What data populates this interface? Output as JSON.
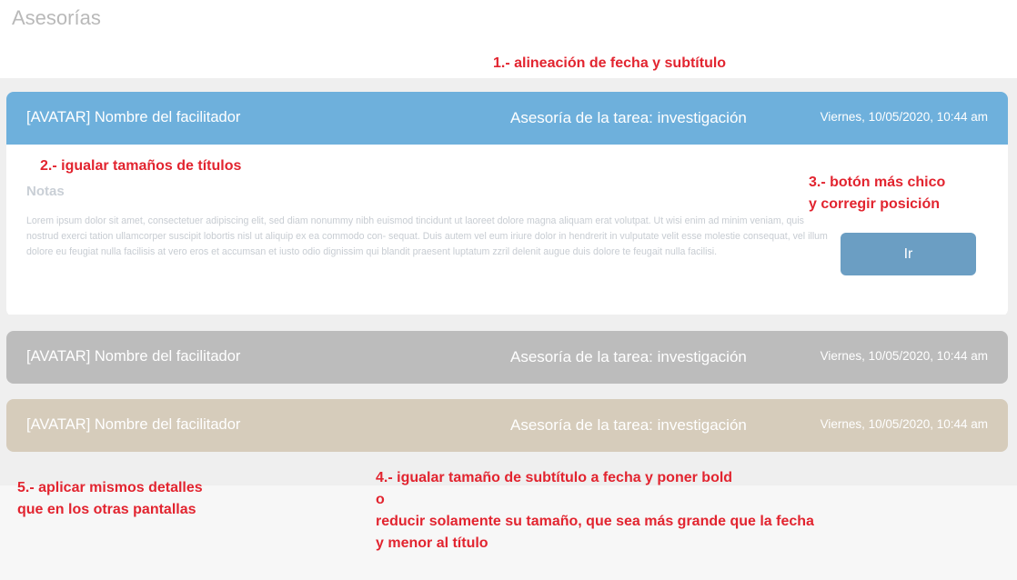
{
  "page": {
    "title": "Asesorías"
  },
  "notes": {
    "n1": "1.- alineación de fecha y subtítulo",
    "n2": "2.- igualar tamaños de títulos",
    "n3": "3.- botón más chico\ny corregir posición",
    "n4": "4.- igualar tamaño de subtítulo a fecha y poner bold\no\nreducir solamente su tamaño, que sea más grande que la fecha\ny menor al título",
    "n5": "5.- aplicar mismos detalles\nque en los otras pantallas"
  },
  "cards": [
    {
      "name": "[AVATAR] Nombre del facilitador",
      "subtitle": "Asesoría de la tarea: investigación",
      "date": "Viernes, 10/05/2020, 10:44 am",
      "color": "#6eb0dc",
      "expanded": true,
      "notes_label": "Notas",
      "notes_text": "Lorem ipsum dolor sit amet, consectetuer adipiscing elit, sed diam nonummy nibh euismod tincidunt ut laoreet dolore magna aliquam erat volutpat. Ut wisi enim ad minim veniam, quis nostrud exerci tation ullamcorper suscipit lobortis nisl ut aliquip ex ea commodo con- sequat. Duis autem vel eum iriure dolor in hendrerit in vulputate velit esse molestie consequat, vel illum dolore eu feugiat nulla facilisis at vero eros et accumsan et iusto odio dignissim qui blandit praesent luptatum zzril delenit augue duis dolore te feugait nulla facilisi.",
      "button_label": "Ir"
    },
    {
      "name": "[AVATAR] Nombre del facilitador",
      "subtitle": "Asesoría de la tarea: investigación",
      "date": "Viernes, 10/05/2020, 10:44 am",
      "color": "#bcbcbc"
    },
    {
      "name": "[AVATAR] Nombre del facilitador",
      "subtitle": "Asesoría de la tarea: investigación",
      "date": "Viernes, 10/05/2020, 10:44 am",
      "color": "#d6ccbb"
    }
  ]
}
